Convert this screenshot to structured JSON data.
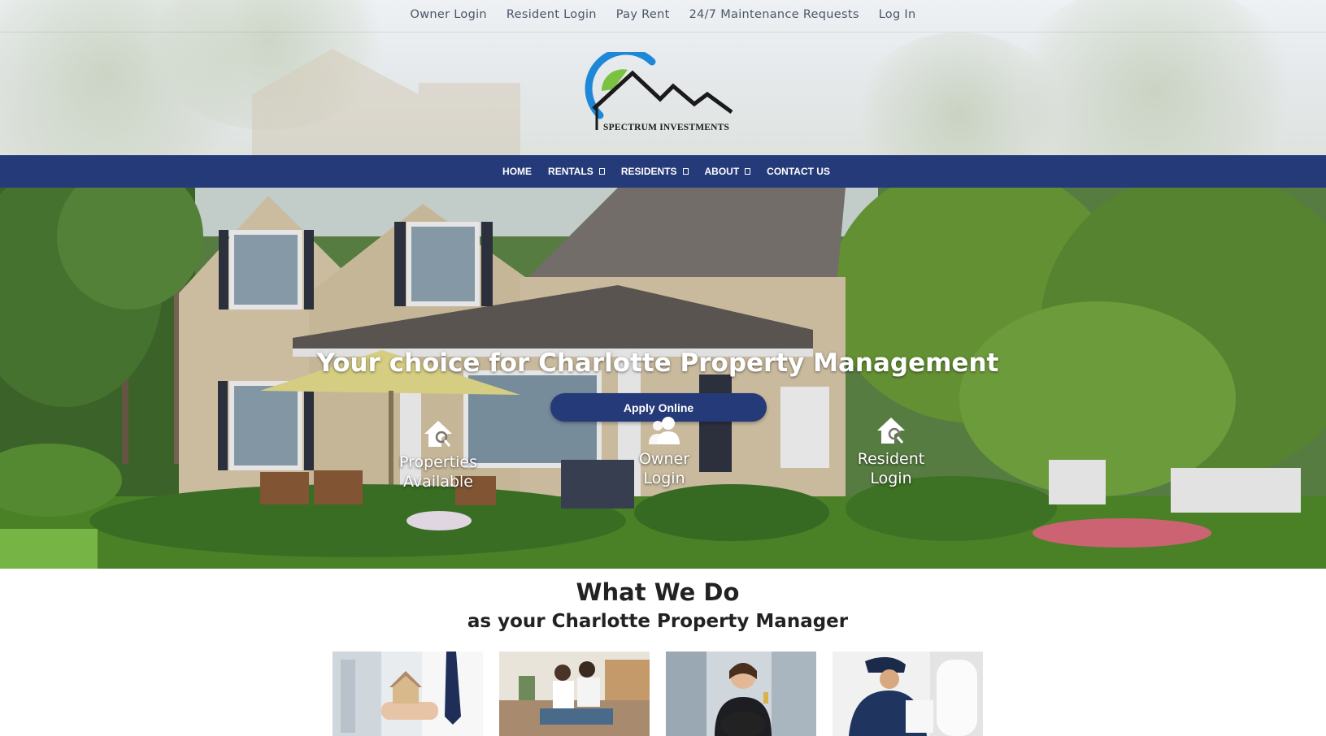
{
  "utility_nav": {
    "items": [
      "Owner Login",
      "Resident Login",
      "Pay Rent",
      "24/7 Maintenance Requests",
      "Log In"
    ]
  },
  "logo": {
    "text": "SPECTRUM INVESTMENTS"
  },
  "main_nav": {
    "items": [
      {
        "label": "HOME",
        "has_dropdown": false
      },
      {
        "label": "RENTALS",
        "has_dropdown": true
      },
      {
        "label": "RESIDENTS",
        "has_dropdown": true
      },
      {
        "label": "ABOUT",
        "has_dropdown": true
      },
      {
        "label": "CONTACT US",
        "has_dropdown": false
      }
    ]
  },
  "hero": {
    "headline": "Your choice for Charlotte Property Management",
    "apply_label": "Apply Online",
    "quick_links": [
      {
        "label_line1": "Properties",
        "label_line2": "Available",
        "icon": "house-search-icon"
      },
      {
        "label_line1": "Owner",
        "label_line2": "Login",
        "icon": "users-icon"
      },
      {
        "label_line1": "Resident",
        "label_line2": "Login",
        "icon": "house-search-icon"
      }
    ]
  },
  "what_we_do": {
    "title": "What We Do",
    "subtitle": "as your Charlotte Property Manager"
  },
  "colors": {
    "brand_navy": "#253a78",
    "logo_blue": "#1e88d8",
    "logo_green": "#7cc242"
  }
}
